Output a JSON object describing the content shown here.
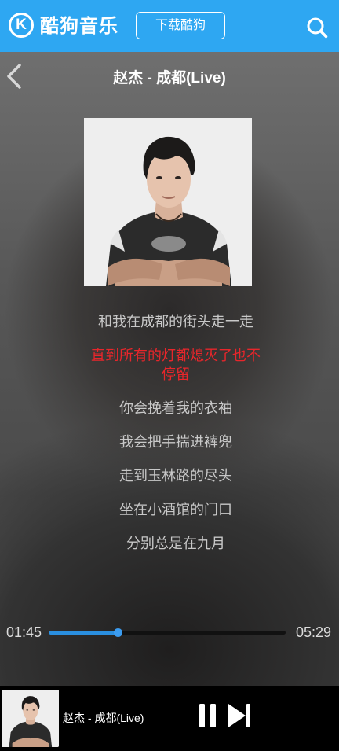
{
  "header": {
    "logo_letter": "K",
    "logo_text": "酷狗音乐",
    "download_label": "下载酷狗",
    "brand_color": "#2ea7f2"
  },
  "player": {
    "song_title": "赵杰 - 成都(Live)",
    "current_time": "01:45",
    "total_time": "05:29",
    "progress": 0.29,
    "accent_color": "#2a8fe0"
  },
  "lyrics": [
    {
      "text": "和我在成都的街头走一走",
      "active": false
    },
    {
      "text": "直到所有的灯都熄灭了也不停留",
      "active": true
    },
    {
      "text": "你会挽着我的衣袖",
      "active": false
    },
    {
      "text": "我会把手揣进裤兜",
      "active": false
    },
    {
      "text": "走到玉林路的尽头",
      "active": false
    },
    {
      "text": "坐在小酒馆的门口",
      "active": false
    },
    {
      "text": "分别总是在九月",
      "active": false
    }
  ],
  "active_lyric_color": "#e8262b",
  "mini_player": {
    "title": "赵杰 - 成都(Live)"
  },
  "icons": [
    "logo-icon",
    "search-icon",
    "back-icon",
    "pause-icon",
    "next-icon"
  ]
}
